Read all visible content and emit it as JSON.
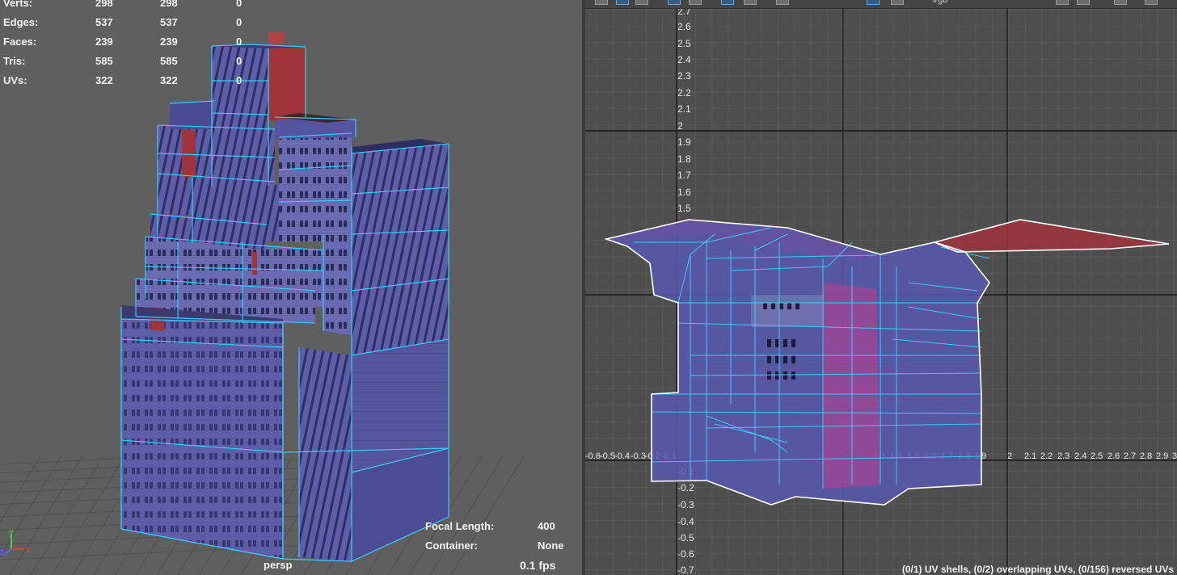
{
  "stats": [
    {
      "label": "Verts:",
      "v1": "298",
      "v2": "298",
      "v3": "0"
    },
    {
      "label": "Edges:",
      "v1": "537",
      "v2": "537",
      "v3": "0"
    },
    {
      "label": "Faces:",
      "v1": "239",
      "v2": "239",
      "v3": "0"
    },
    {
      "label": "Tris:",
      "v1": "585",
      "v2": "585",
      "v3": "0"
    },
    {
      "label": "UVs:",
      "v1": "322",
      "v2": "322",
      "v3": "0"
    }
  ],
  "camera": {
    "name": "persp",
    "focal_length_label": "Focal Length:",
    "focal_length_value": "400",
    "container_label": "Container:",
    "container_value": "None",
    "fps": "0.1 fps"
  },
  "axes": {
    "x": "x",
    "y": "y",
    "z": "z"
  },
  "uv_editor": {
    "toolbar_text": "lrgb",
    "v_ticks": [
      "2.7",
      "2.6",
      "2.5",
      "2.4",
      "2.3",
      "2.2",
      "2.1",
      "2",
      "1.9",
      "1.8",
      "1.7",
      "1.6",
      "1.5",
      "-0.1",
      "-0.2",
      "-0.3",
      "-0.4",
      "-0.5",
      "-0.6",
      "-0.7"
    ],
    "u_ticks": [
      "-0.6",
      "-0.5",
      "-0.4",
      "-0.3",
      "-0.2",
      "-0.1",
      "1.3",
      "1.4",
      "1.5",
      "1.6",
      "1.7",
      "1.8",
      "1.9",
      "2",
      "2.1",
      "2.2",
      "2.3",
      "2.4",
      "2.5",
      "2.6",
      "2.7",
      "2.8",
      "2.9",
      "3"
    ],
    "status": "(0/1) UV shells, (0/2) overlapping UVs, (0/156) reversed UVs"
  },
  "colors": {
    "viewport_bg": "#5f5f5f",
    "uv_bg": "#4e4e4e",
    "wire_cyan": "#3fc8ff",
    "mesh_face": "#5a5aa8",
    "red_face": "#a0343c",
    "magenta_face": "#c04090",
    "boundary_white": "#ffffff"
  }
}
